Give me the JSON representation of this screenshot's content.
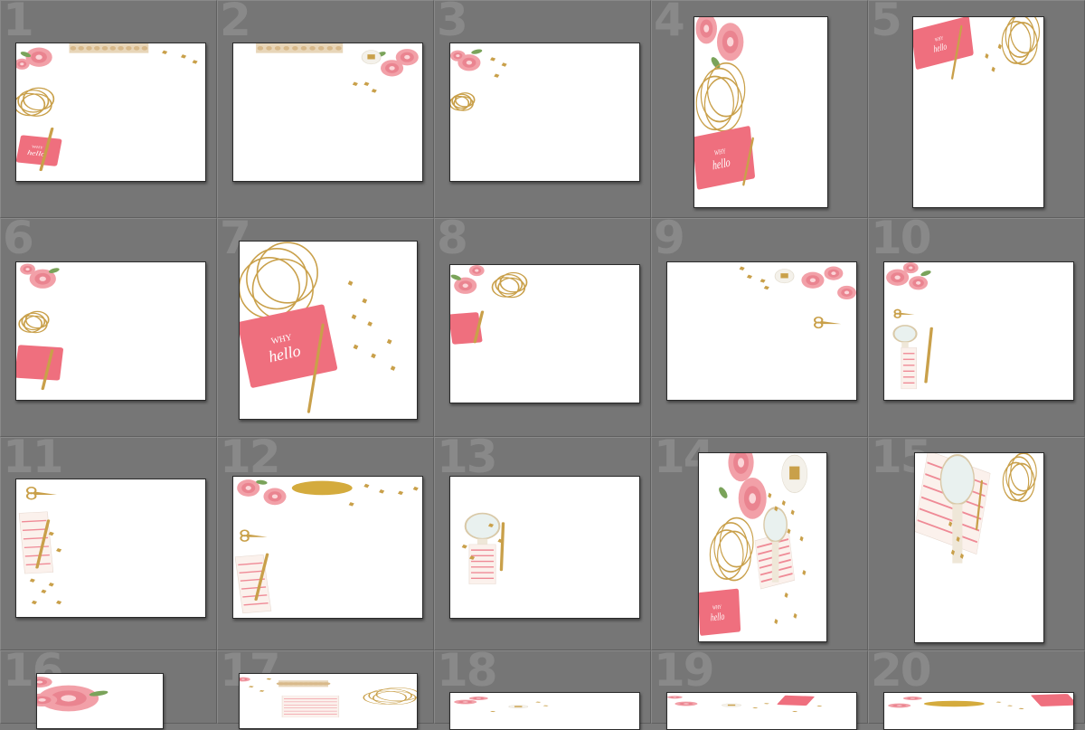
{
  "thumbnails": [
    {
      "number": "1"
    },
    {
      "number": "2"
    },
    {
      "number": "3"
    },
    {
      "number": "4"
    },
    {
      "number": "5"
    },
    {
      "number": "6"
    },
    {
      "number": "7"
    },
    {
      "number": "8"
    },
    {
      "number": "9"
    },
    {
      "number": "10"
    },
    {
      "number": "11"
    },
    {
      "number": "12"
    },
    {
      "number": "13"
    },
    {
      "number": "14"
    },
    {
      "number": "15"
    },
    {
      "number": "16"
    },
    {
      "number": "17"
    },
    {
      "number": "18"
    },
    {
      "number": "19"
    },
    {
      "number": "20"
    }
  ],
  "card_text": {
    "line1": "WHY",
    "line2": "hello"
  },
  "colors": {
    "background": "#767676",
    "rose": "#f2a0a8",
    "rose_dark": "#e36d7c",
    "card_pink": "#ef6f7e",
    "gold": "#c9a04a",
    "leaf": "#7aa35a"
  }
}
